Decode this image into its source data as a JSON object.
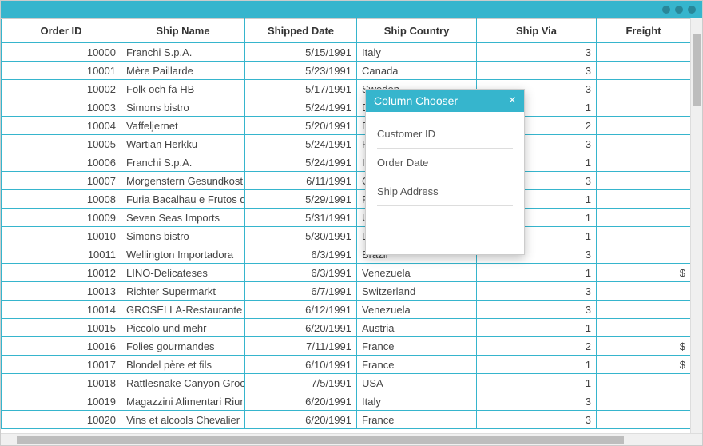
{
  "columns": {
    "order_id": "Order ID",
    "ship_name": "Ship Name",
    "shipped_date": "Shipped Date",
    "ship_country": "Ship Country",
    "ship_via": "Ship Via",
    "freight": "Freight"
  },
  "rows": [
    {
      "id": "10000",
      "name": "Franchi S.p.A.",
      "date": "5/15/1991",
      "country": "Italy",
      "via": "3",
      "freight": ""
    },
    {
      "id": "10001",
      "name": "Mère Paillarde",
      "date": "5/23/1991",
      "country": "Canada",
      "via": "3",
      "freight": ""
    },
    {
      "id": "10002",
      "name": "Folk och fä HB",
      "date": "5/17/1991",
      "country": "Sweden",
      "via": "3",
      "freight": ""
    },
    {
      "id": "10003",
      "name": "Simons bistro",
      "date": "5/24/1991",
      "country": "Denmark",
      "via": "1",
      "freight": ""
    },
    {
      "id": "10004",
      "name": "Vaffeljernet",
      "date": "5/20/1991",
      "country": "Denmark",
      "via": "2",
      "freight": ""
    },
    {
      "id": "10005",
      "name": "Wartian Herkku",
      "date": "5/24/1991",
      "country": "Finland",
      "via": "3",
      "freight": ""
    },
    {
      "id": "10006",
      "name": "Franchi S.p.A.",
      "date": "5/24/1991",
      "country": "Italy",
      "via": "1",
      "freight": ""
    },
    {
      "id": "10007",
      "name": "Morgenstern Gesundkost",
      "date": "6/11/1991",
      "country": "Germany",
      "via": "3",
      "freight": ""
    },
    {
      "id": "10008",
      "name": "Furia Bacalhau e Frutos do M",
      "date": "5/29/1991",
      "country": "Portugal",
      "via": "1",
      "freight": ""
    },
    {
      "id": "10009",
      "name": "Seven Seas Imports",
      "date": "5/31/1991",
      "country": "UK",
      "via": "1",
      "freight": ""
    },
    {
      "id": "10010",
      "name": "Simons bistro",
      "date": "5/30/1991",
      "country": "Denmark",
      "via": "1",
      "freight": ""
    },
    {
      "id": "10011",
      "name": "Wellington Importadora",
      "date": "6/3/1991",
      "country": "Brazil",
      "via": "3",
      "freight": ""
    },
    {
      "id": "10012",
      "name": "LINO-Delicateses",
      "date": "6/3/1991",
      "country": "Venezuela",
      "via": "1",
      "freight": "$"
    },
    {
      "id": "10013",
      "name": "Richter Supermarkt",
      "date": "6/7/1991",
      "country": "Switzerland",
      "via": "3",
      "freight": ""
    },
    {
      "id": "10014",
      "name": "GROSELLA-Restaurante",
      "date": "6/12/1991",
      "country": "Venezuela",
      "via": "3",
      "freight": ""
    },
    {
      "id": "10015",
      "name": "Piccolo und mehr",
      "date": "6/20/1991",
      "country": "Austria",
      "via": "1",
      "freight": ""
    },
    {
      "id": "10016",
      "name": "Folies gourmandes",
      "date": "7/11/1991",
      "country": "France",
      "via": "2",
      "freight": "$"
    },
    {
      "id": "10017",
      "name": "Blondel père et fils",
      "date": "6/10/1991",
      "country": "France",
      "via": "1",
      "freight": "$"
    },
    {
      "id": "10018",
      "name": "Rattlesnake Canyon Grocery",
      "date": "7/5/1991",
      "country": "USA",
      "via": "1",
      "freight": ""
    },
    {
      "id": "10019",
      "name": "Magazzini Alimentari Riunit",
      "date": "6/20/1991",
      "country": "Italy",
      "via": "3",
      "freight": ""
    },
    {
      "id": "10020",
      "name": "Vins et alcools Chevalier",
      "date": "6/20/1991",
      "country": "France",
      "via": "3",
      "freight": ""
    }
  ],
  "chooser": {
    "title": "Column Chooser",
    "items": [
      "Customer ID",
      "Order Date",
      "Ship Address"
    ]
  }
}
